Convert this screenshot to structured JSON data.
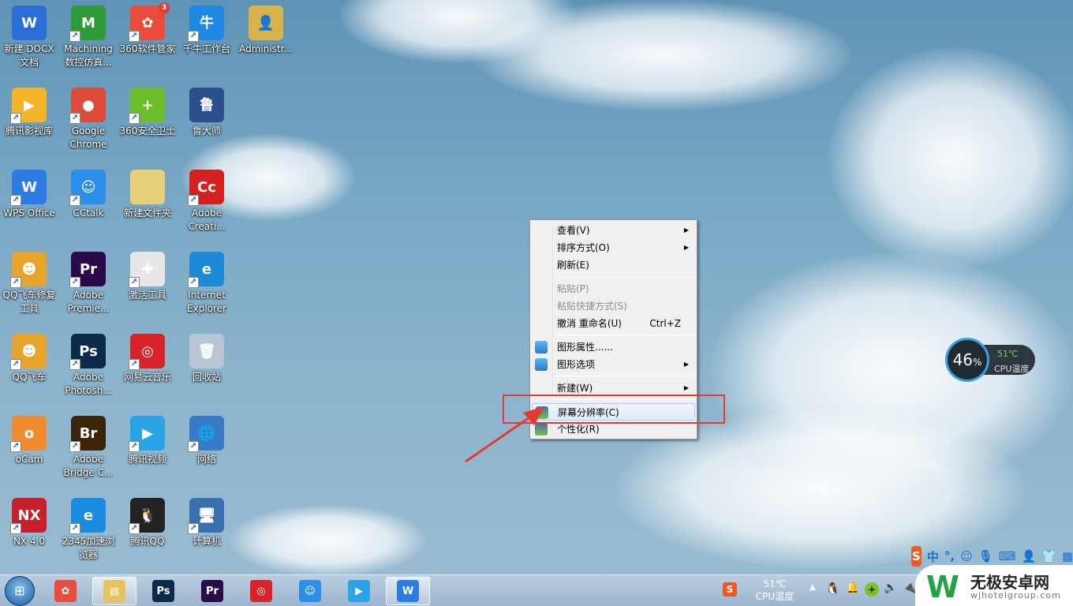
{
  "desktop": {
    "icons": [
      {
        "label": "新建 DOCX 文档",
        "color": "#2b6fd6",
        "glyph": "W"
      },
      {
        "label": "Machining 数控仿真...",
        "color": "#2f9a3a",
        "glyph": "M"
      },
      {
        "label": "360软件管家",
        "color": "#e94c3d",
        "glyph": "✿",
        "badge": "3"
      },
      {
        "label": "千牛工作台",
        "color": "#1e88e5",
        "glyph": "牛"
      },
      {
        "label": "Administr...",
        "color": "#d8b24a",
        "glyph": "👤"
      },
      {
        "label": "腾讯影视库",
        "color": "#f3b428",
        "glyph": "▶"
      },
      {
        "label": "Google Chrome",
        "color": "#dd4b39",
        "glyph": "●"
      },
      {
        "label": "360安全卫士",
        "color": "#6cbf2a",
        "glyph": "+"
      },
      {
        "label": "鲁大师",
        "color": "#2b4f8a",
        "glyph": "鲁"
      },
      null,
      {
        "label": "WPS Office",
        "color": "#2d7be5",
        "glyph": "W"
      },
      {
        "label": "CCtalk",
        "color": "#2b8ee8",
        "glyph": "☺"
      },
      {
        "label": "新建文件夹",
        "color": "#e8cf7a",
        "glyph": ""
      },
      {
        "label": "Adobe Creati...",
        "color": "#d4201f",
        "glyph": "Cc"
      },
      null,
      {
        "label": "QQ飞车修复工具",
        "color": "#e6a42b",
        "glyph": "☻"
      },
      {
        "label": "Adobe Premie...",
        "color": "#2a0a4a",
        "glyph": "Pr"
      },
      {
        "label": "激活工具",
        "color": "#e7e7e7",
        "glyph": "✚"
      },
      {
        "label": "Internet Explorer",
        "color": "#1d8ad6",
        "glyph": "e"
      },
      null,
      {
        "label": "QQ飞车",
        "color": "#e6a42b",
        "glyph": "☻"
      },
      {
        "label": "Adobe Photosh...",
        "color": "#0b2a4a",
        "glyph": "Ps"
      },
      {
        "label": "网易云音乐",
        "color": "#d8232a",
        "glyph": "◎"
      },
      {
        "label": "回收站",
        "color": "#b7c6d2",
        "glyph": "🗑"
      },
      null,
      {
        "label": "oCam",
        "color": "#f08a2c",
        "glyph": "o"
      },
      {
        "label": "Adobe Bridge C...",
        "color": "#3a2508",
        "glyph": "Br"
      },
      {
        "label": "腾讯视频",
        "color": "#2aa4e6",
        "glyph": "▶"
      },
      {
        "label": "网络",
        "color": "#3a7bc8",
        "glyph": "🌐"
      },
      null,
      {
        "label": "NX 4.0",
        "color": "#c8202a",
        "glyph": "NX"
      },
      {
        "label": "2345加速浏览器",
        "color": "#1a8be0",
        "glyph": "e"
      },
      {
        "label": "腾讯QQ",
        "color": "#222222",
        "glyph": "🐧"
      },
      {
        "label": "计算机",
        "color": "#3a6fb0",
        "glyph": "🖥"
      }
    ]
  },
  "context_menu": {
    "items": [
      {
        "label": "查看(V)",
        "submenu": true
      },
      {
        "label": "排序方式(O)",
        "submenu": true
      },
      {
        "label": "刷新(E)"
      },
      {
        "sep": true
      },
      {
        "label": "粘贴(P)",
        "disabled": true
      },
      {
        "label": "粘贴快捷方式(S)",
        "disabled": true
      },
      {
        "label": "撤消 重命名(U)",
        "shortcut": "Ctrl+Z"
      },
      {
        "sep": true
      },
      {
        "label": "图形属性......",
        "icon": "intel-graphics-icon"
      },
      {
        "label": "图形选项",
        "icon": "intel-graphics-icon",
        "submenu": true
      },
      {
        "sep": true
      },
      {
        "label": "新建(W)",
        "submenu": true
      },
      {
        "sep": true
      },
      {
        "label": "屏幕分辨率(C)",
        "icon": "display-icon",
        "highlighted": true
      },
      {
        "label": "个性化(R)",
        "icon": "personalize-icon"
      }
    ]
  },
  "cpu_widget": {
    "usage": "46",
    "unit": "%",
    "temp": "51℃",
    "temp_label": "CPU温度"
  },
  "ime_bar": {
    "lang": "中",
    "punct": "°,"
  },
  "taskbar": {
    "apps": [
      {
        "name": "360-icon",
        "color": "#e94c3d",
        "glyph": "✿"
      },
      {
        "name": "explorer-icon",
        "color": "#e8c25a",
        "glyph": "▤",
        "active": true
      },
      {
        "name": "photoshop-icon",
        "color": "#0b2a4a",
        "glyph": "Ps"
      },
      {
        "name": "premiere-icon",
        "color": "#2a0a4a",
        "glyph": "Pr"
      },
      {
        "name": "netease-music-icon",
        "color": "#d8232a",
        "glyph": "◎"
      },
      {
        "name": "cctalk-icon",
        "color": "#2b8ee8",
        "glyph": "☺"
      },
      {
        "name": "tencent-video-icon",
        "color": "#2aa4e6",
        "glyph": "▶"
      },
      {
        "name": "wps-icon",
        "color": "#2d7be5",
        "glyph": "W",
        "active": true
      }
    ],
    "cpu_temp": "51℃",
    "cpu_label": "CPU温度"
  },
  "watermark": {
    "brand": "无极安卓网",
    "url": "wjhotelgroup.com"
  },
  "colors": {
    "highlight_box": "#e53935",
    "accent": "#2d7be5"
  }
}
